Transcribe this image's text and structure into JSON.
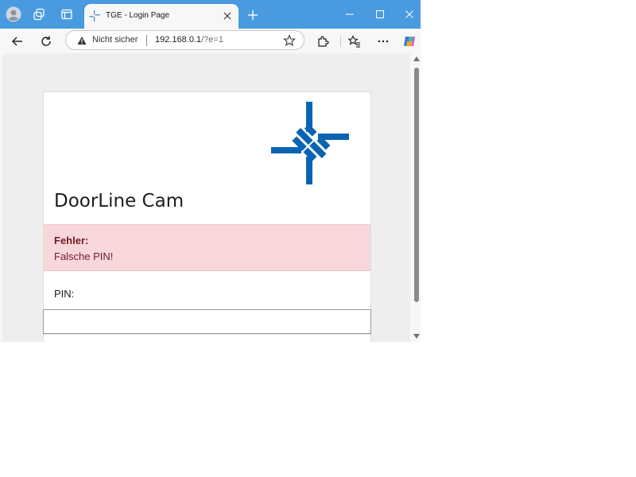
{
  "browser": {
    "tab_title": "TGE - Login Page",
    "address": {
      "security_label": "Nicht sicher",
      "url_host": "192.168.0.1",
      "url_rest": "/?e=1"
    },
    "icons": [
      "profile-icon",
      "workspaces-icon",
      "tab-actions-icon",
      "tab-favicon",
      "close-icon",
      "new-tab-icon",
      "minimize-icon",
      "maximize-icon",
      "close-window-icon",
      "back-icon",
      "refresh-icon",
      "warning-icon",
      "favorite-star-icon",
      "extensions-icon",
      "favorites-icon",
      "more-icon",
      "copilot-icon"
    ],
    "accent_color": "#4a9ae0"
  },
  "page": {
    "app_title": "DoorLine Cam",
    "error": {
      "heading": "Fehler:",
      "message": "Falsche PIN!"
    },
    "pin_label": "PIN:",
    "pin_value": "",
    "logo_color": "#0a64b4",
    "alert_background": "#f8d7da",
    "alert_text_color": "#721c24"
  }
}
